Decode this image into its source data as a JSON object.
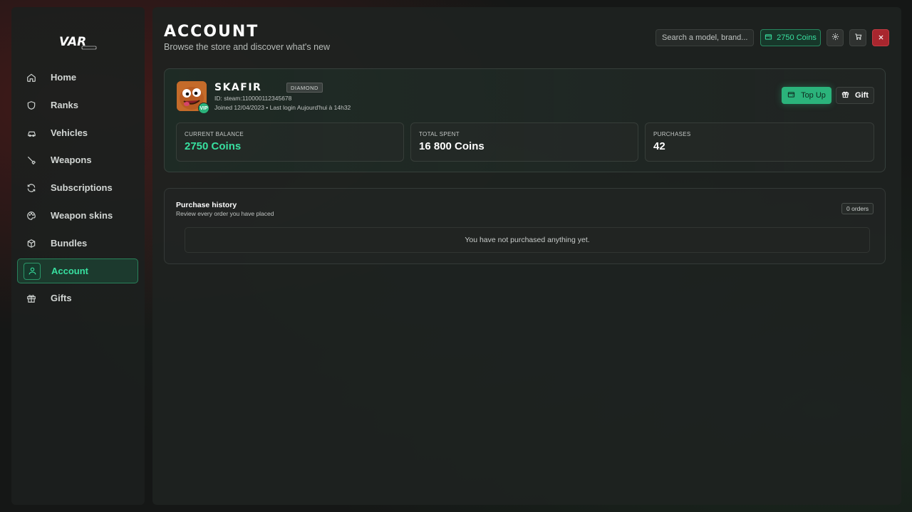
{
  "brand": {
    "logo_text": "VAR"
  },
  "sidebar": {
    "items": [
      {
        "label": "Home",
        "icon": "home-icon",
        "active": false
      },
      {
        "label": "Ranks",
        "icon": "shield-icon",
        "active": false
      },
      {
        "label": "Vehicles",
        "icon": "car-icon",
        "active": false
      },
      {
        "label": "Weapons",
        "icon": "knife-icon",
        "active": false
      },
      {
        "label": "Subscriptions",
        "icon": "refresh-icon",
        "active": false
      },
      {
        "label": "Weapon skins",
        "icon": "palette-icon",
        "active": false
      },
      {
        "label": "Bundles",
        "icon": "box-icon",
        "active": false
      },
      {
        "label": "Account",
        "icon": "user-icon",
        "active": true
      },
      {
        "label": "Gifts",
        "icon": "gift-icon",
        "active": false
      }
    ]
  },
  "header": {
    "title": "ACCOUNT",
    "subtitle": "Browse the store and discover what's new",
    "search_placeholder": "Search a model, brand...",
    "coins_label": "2750 Coins"
  },
  "profile": {
    "username": "SKAFIR",
    "rank": "DIAMOND",
    "vip_label": "VIP",
    "id_line": "ID: steam:110000112345678",
    "joined_line": "Joined 12/04/2023 • Last login Aujourd'hui à 14h32",
    "topup_label": "Top Up",
    "gift_label": "Gift"
  },
  "stats": [
    {
      "label": "CURRENT BALANCE",
      "value": "2750 Coins"
    },
    {
      "label": "TOTAL SPENT",
      "value": "16 800 Coins"
    },
    {
      "label": "PURCHASES",
      "value": "42"
    }
  ],
  "history": {
    "title": "Purchase history",
    "subtitle": "Review every order you have placed",
    "orders_badge": "0 orders",
    "empty_message": "You have not purchased anything yet."
  },
  "colors": {
    "accent": "#38e0a0",
    "accent_button": "#2bb37b",
    "danger": "#a8262e"
  }
}
